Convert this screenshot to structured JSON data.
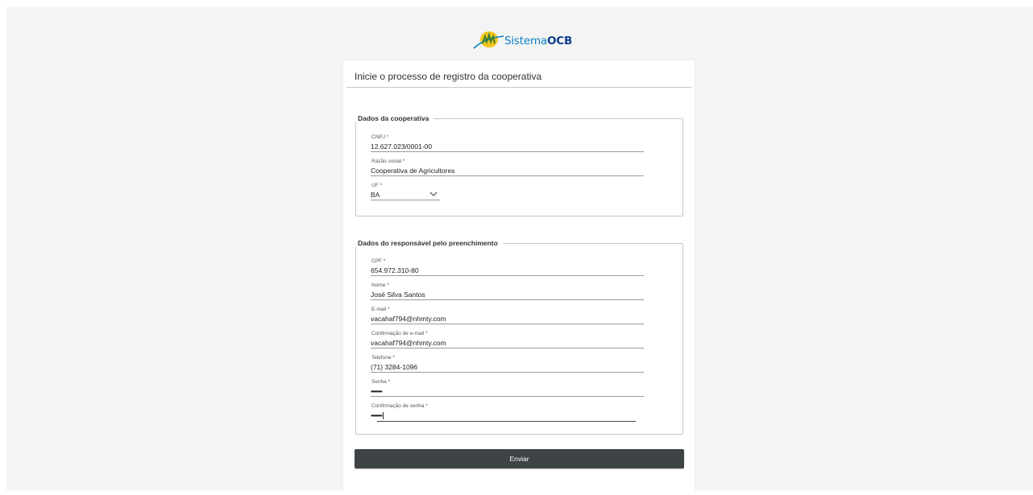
{
  "logo": {
    "prefix": "Sistema",
    "suffix": "OCB"
  },
  "card": {
    "title": "Inicie o processo de registro da cooperativa"
  },
  "cooperativa": {
    "legend": "Dados da cooperativa",
    "cnpj": {
      "label": "CNPJ *",
      "value": "12.627.023/0001-00"
    },
    "razao": {
      "label": "Razão social *",
      "value": "Cooperativa de Agricultores"
    },
    "uf": {
      "label": "UF *",
      "value": "BA"
    }
  },
  "responsavel": {
    "legend": "Dados do responsável pelo preenchimento",
    "cpf": {
      "label": "CPF *",
      "value": "654.972.310-80"
    },
    "nome": {
      "label": "Nome *",
      "value": "José Silva Santos"
    },
    "email": {
      "label": "E-mail *",
      "value": "vacahaf794@nhmty.com"
    },
    "email_conf": {
      "label": "Confirmação de e-mail *",
      "value": "vacahaf794@nhmty.com"
    },
    "telefone": {
      "label": "Telefone *",
      "value": "(71) 3284-1096"
    },
    "senha": {
      "label": "Senha *",
      "value": "•••••••••"
    },
    "senha_conf": {
      "label": "Confirmação de senha *",
      "value": "•••••••••"
    }
  },
  "submit": {
    "label": "Enviar"
  },
  "colors": {
    "brand_blue": "#0a7fc6",
    "brand_dark": "#0a3e8c",
    "button": "#3e4346"
  }
}
